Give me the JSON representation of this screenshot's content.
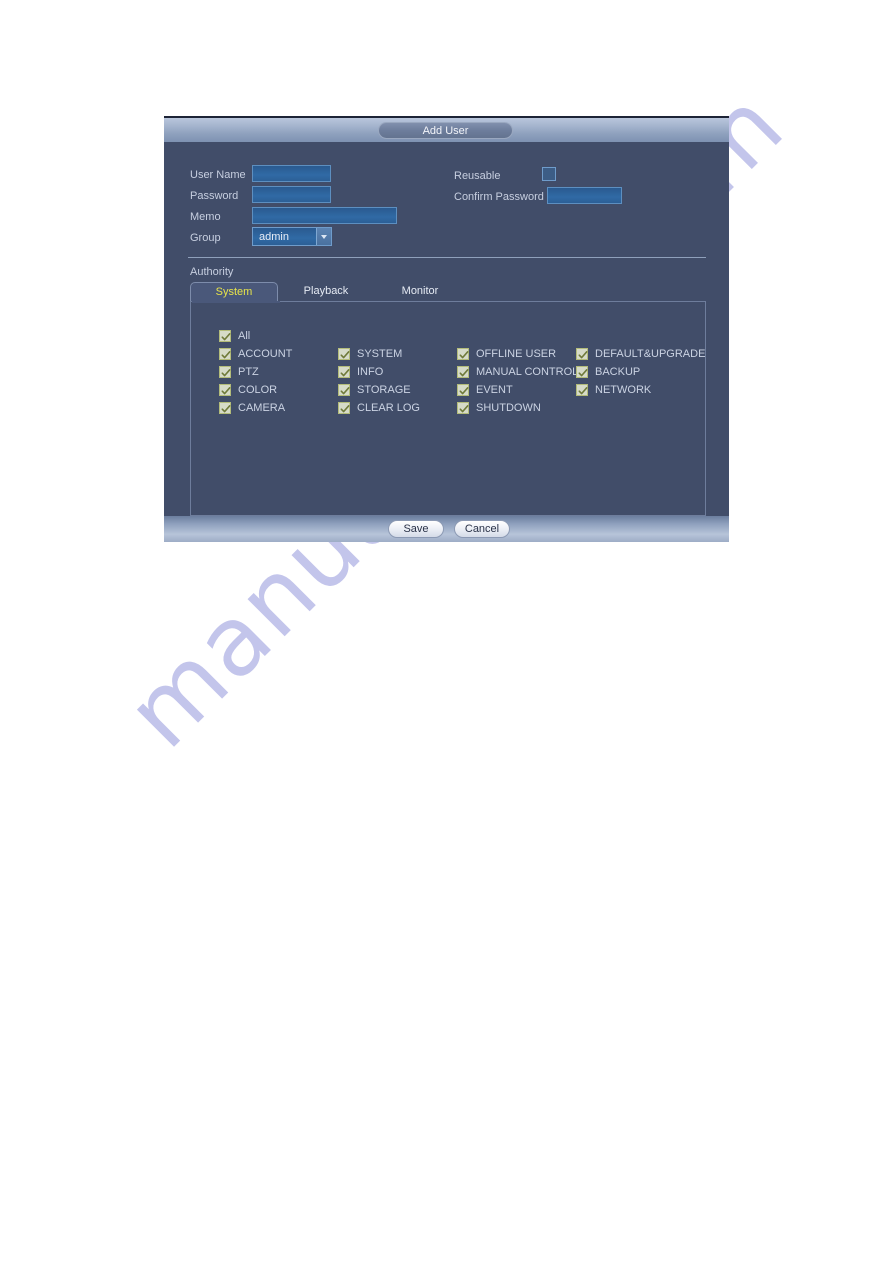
{
  "dialog": {
    "title": "Add User",
    "form": {
      "username_label": "User Name",
      "username_value": "",
      "password_label": "Password",
      "password_value": "",
      "memo_label": "Memo",
      "memo_value": "",
      "group_label": "Group",
      "group_value": "admin",
      "reusable_label": "Reusable",
      "reusable_checked": false,
      "confirm_password_label": "Confirm Password",
      "confirm_password_value": ""
    },
    "authority": {
      "section_label": "Authority",
      "tabs": [
        {
          "label": "System",
          "active": true
        },
        {
          "label": "Playback",
          "active": false
        },
        {
          "label": "Monitor",
          "active": false
        }
      ],
      "columns": [
        {
          "items": [
            {
              "label": "All",
              "checked": true
            },
            {
              "label": "ACCOUNT",
              "checked": true
            },
            {
              "label": "PTZ",
              "checked": true
            },
            {
              "label": "COLOR",
              "checked": true
            },
            {
              "label": "CAMERA",
              "checked": true
            }
          ]
        },
        {
          "items": [
            {
              "label": "SYSTEM",
              "checked": true
            },
            {
              "label": "INFO",
              "checked": true
            },
            {
              "label": "STORAGE",
              "checked": true
            },
            {
              "label": "CLEAR LOG",
              "checked": true
            }
          ]
        },
        {
          "items": [
            {
              "label": "OFFLINE USER",
              "checked": true
            },
            {
              "label": "MANUAL CONTROL",
              "checked": true
            },
            {
              "label": "EVENT",
              "checked": true
            },
            {
              "label": "SHUTDOWN",
              "checked": true
            }
          ]
        },
        {
          "items": [
            {
              "label": "DEFAULT&UPGRADE",
              "checked": true
            },
            {
              "label": "BACKUP",
              "checked": true
            },
            {
              "label": "NETWORK",
              "checked": true
            }
          ]
        }
      ]
    },
    "footer": {
      "save_label": "Save",
      "cancel_label": "Cancel"
    }
  },
  "watermark": {
    "text": "manualshive.com"
  },
  "colors": {
    "dialog_body": "#414d69",
    "field_blue": "#2c5f96",
    "active_tab_text": "#e8e44a",
    "label_text": "#c7cfe0",
    "checkbox_fill": "#d6dbc8",
    "checkbox_border": "#b3bc7a",
    "watermark": "#b9bbe8"
  }
}
